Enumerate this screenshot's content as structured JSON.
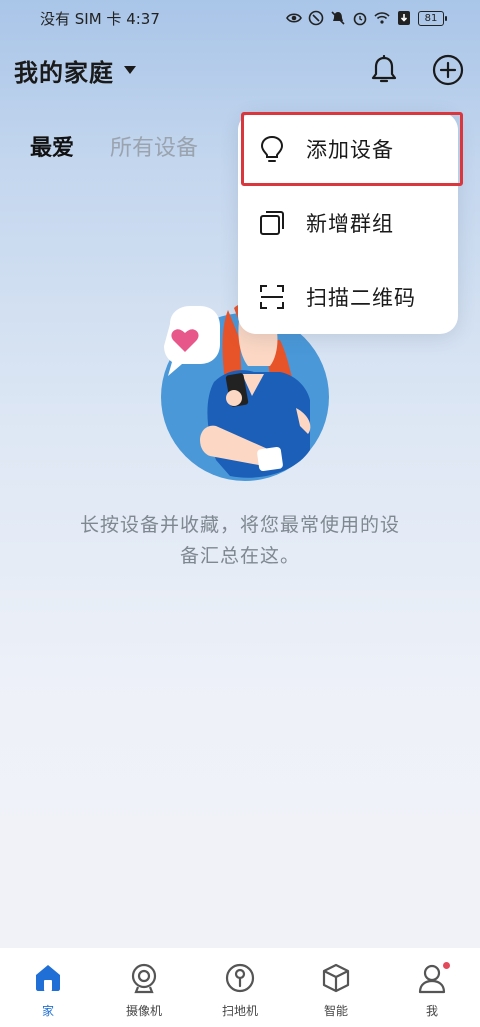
{
  "status_bar": {
    "left_text": "没有 SIM 卡 4:37",
    "battery": "81",
    "icons": [
      "eye-icon",
      "nfc-icon",
      "mute-icon",
      "alarm-icon",
      "wifi-icon",
      "download-icon",
      "battery-icon"
    ]
  },
  "header": {
    "home_name": "我的家庭",
    "icons": [
      "bell-icon",
      "add-circle-icon"
    ]
  },
  "tabs": [
    {
      "label": "最爱",
      "active": true
    },
    {
      "label": "所有设备",
      "active": false
    }
  ],
  "menu": {
    "items": [
      {
        "label": "添加设备",
        "icon": "lightbulb-icon",
        "highlighted": true
      },
      {
        "label": "新增群组",
        "icon": "group-icon"
      },
      {
        "label": "扫描二维码",
        "icon": "scan-icon"
      }
    ],
    "highlight_color": "#d9363e"
  },
  "empty_state": {
    "line1": "长按设备并收藏，将您最常使用的设",
    "line2": "备汇总在这。"
  },
  "bottom_nav": {
    "items": [
      {
        "label": "家",
        "icon": "home-icon",
        "active": true
      },
      {
        "label": "摄像机",
        "icon": "camera-icon"
      },
      {
        "label": "扫地机",
        "icon": "robot-vacuum-icon"
      },
      {
        "label": "智能",
        "icon": "cube-icon"
      },
      {
        "label": "我",
        "icon": "person-icon",
        "badge": true
      }
    ]
  },
  "colors": {
    "accent": "#1f6fd6",
    "heart": "#e8578a",
    "illustration_circle": "#4a98d8",
    "shirt": "#1b5fb8",
    "hair": "#e8542a"
  }
}
